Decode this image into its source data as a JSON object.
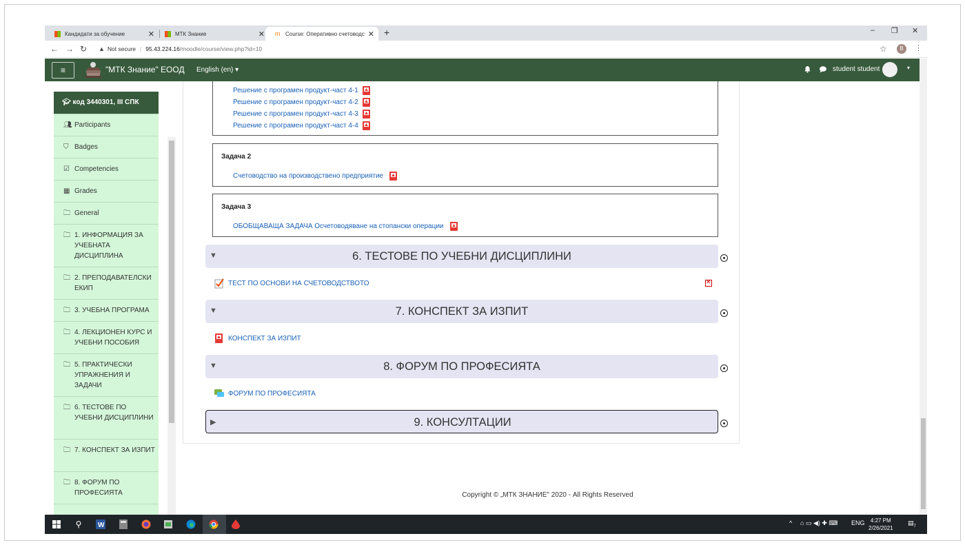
{
  "browser": {
    "tabs": [
      {
        "label": "Кандидати за обучение",
        "close": "✕"
      },
      {
        "label": "МТК Знание",
        "close": "✕"
      },
      {
        "label": "Course: Оперативно счетоводс",
        "close": "✕"
      }
    ],
    "new_tab": "+",
    "window_controls": {
      "minimize": "–",
      "restore": "❐",
      "close": "✕"
    },
    "nav": {
      "back": "←",
      "forward": "→",
      "reload": "↻"
    },
    "security_warning": "Not secure",
    "url_host": "95.43.224.16",
    "url_path": "/moodle/course/view.php?id=10",
    "bookmark_icon": "☆",
    "profile_initial": "B",
    "menu_icon": "⋮"
  },
  "navbar": {
    "menu_icon": "≡",
    "brand": "\"МТК Знание\" ЕООД",
    "language": "English (en) ▾",
    "notification_icon": "bell-icon",
    "messages_icon": "chat-icon",
    "user_name": "student student",
    "user_caret": "▾"
  },
  "drawer": {
    "active": "код 3440301, III СПК",
    "items": [
      {
        "icon": "users-icon",
        "label": "Participants"
      },
      {
        "icon": "shield-icon",
        "label": "Badges"
      },
      {
        "icon": "check-square-icon",
        "label": "Competencies"
      },
      {
        "icon": "table-icon",
        "label": "Grades"
      },
      {
        "icon": "folder-icon",
        "label": "General"
      },
      {
        "icon": "folder-icon",
        "label": "1. ИНФОРМАЦИЯ ЗА УЧЕБНАТА ДИСЦИПЛИНА"
      },
      {
        "icon": "folder-icon",
        "label": "2. ПРЕПОДАВАТЕЛСКИ ЕКИП"
      },
      {
        "icon": "folder-icon",
        "label": "3. УЧЕБНА ПРОГРАМА"
      },
      {
        "icon": "folder-icon",
        "label": "4. ЛЕКЦИОНЕН КУРС И УЧЕБНИ ПОСОБИЯ"
      },
      {
        "icon": "folder-icon",
        "label": "5. ПРАКТИЧЕСКИ УПРАЖНЕНИЯ И ЗАДАЧИ"
      },
      {
        "icon": "folder-icon",
        "label": "6. ТЕСТОВЕ ПО УЧЕБНИ ДИСЦИПЛИНИ"
      },
      {
        "icon": "folder-icon",
        "label": "7. КОНСПЕКТ ЗА ИЗПИТ"
      },
      {
        "icon": "folder-icon",
        "label": "8. ФОРУМ ПО ПРОФЕСИЯТА"
      }
    ]
  },
  "content": {
    "task1_links": [
      "Решение с програмен продукт-част 4-1",
      "Решение с програмен продукт-част 4-2",
      "Решение с програмен продукт-част 4-3",
      "Решение с програмен продукт-част 4-4"
    ],
    "task2": {
      "title": "Задача 2",
      "link": "Счетоводство на производствено предприятие"
    },
    "task3": {
      "title": "Задача 3",
      "link": "ОБОБЩАВАЩА ЗАДАЧА Осчетоводяване на стопански операции"
    },
    "sections": [
      {
        "title": "6. ТЕСТОВЕ ПО УЧЕБНИ ДИСЦИПЛИНИ",
        "toggle": "▼",
        "activity": "ТЕСТ ПО ОСНОВИ НА СЧЕТОВОДСТВОТО",
        "activity_icon": "quiz-icon",
        "completion": "failed"
      },
      {
        "title": "7. КОНСПЕКТ ЗА ИЗПИТ",
        "toggle": "▼",
        "activity": "КОНСПЕКТ ЗА ИЗПИТ",
        "activity_icon": "pdf-icon",
        "completion": "incomplete"
      },
      {
        "title": "8. ФОРУМ ПО ПРОФЕСИЯТА",
        "toggle": "▼",
        "activity": "ФОРУМ ПО ПРОФЕСИЯТА",
        "activity_icon": "forum-icon",
        "completion": "incomplete"
      },
      {
        "title": "9. КОНСУЛТАЦИИ",
        "toggle": "▶"
      }
    ]
  },
  "footer": "Copyright © „МТК ЗНАНИЕ\" 2020 - All Rights Reserved",
  "taskbar": {
    "language": "ENG",
    "time": "4:27 PM",
    "date": "2/26/2021",
    "notifications": "7"
  },
  "colors": {
    "navbar": "#375a3c",
    "drawer_bg": "#d4f7d9",
    "section_bg": "#e4e4f3",
    "link": "#1a61b7"
  }
}
